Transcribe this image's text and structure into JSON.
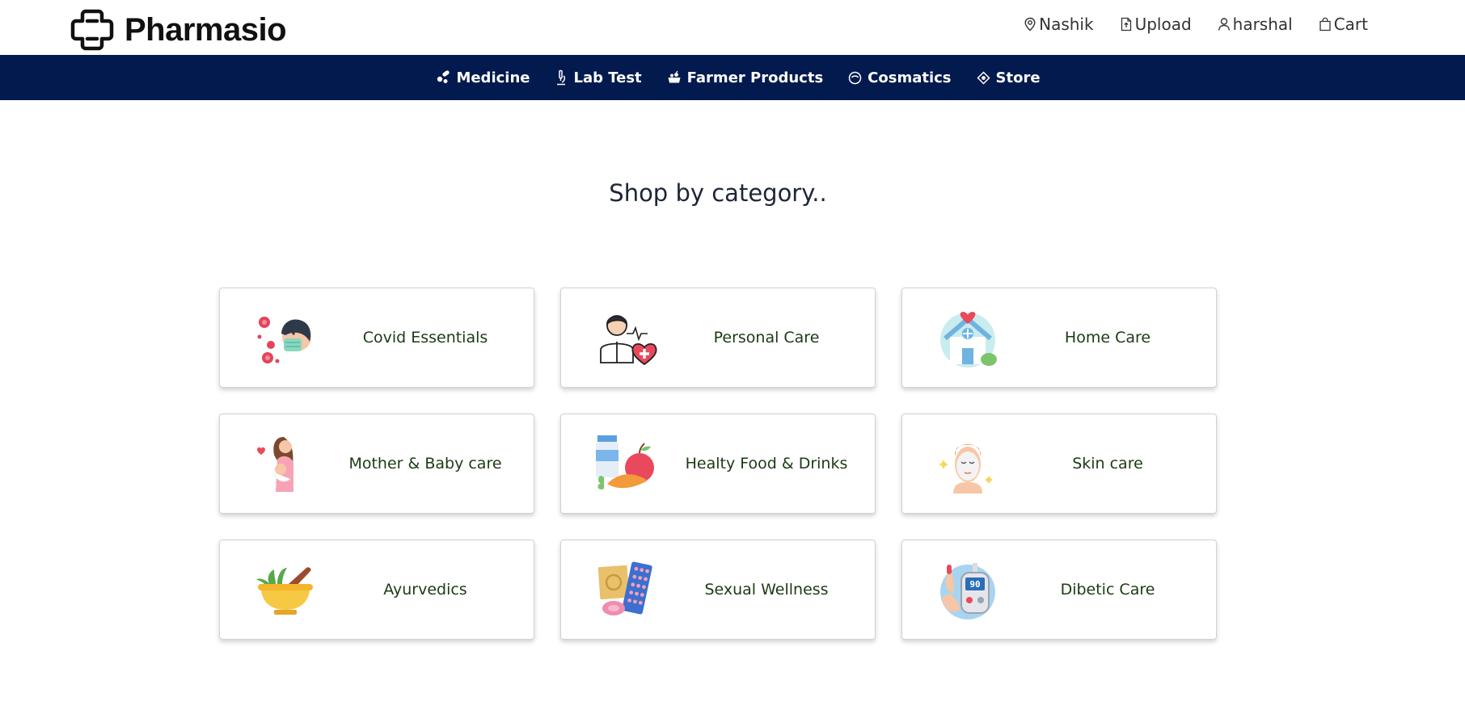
{
  "header": {
    "brand": "Pharmasio",
    "links": [
      {
        "label": "Nashik",
        "icon": "location-pin-icon"
      },
      {
        "label": "Upload",
        "icon": "file-upload-icon"
      },
      {
        "label": "harshal",
        "icon": "user-icon"
      },
      {
        "label": "Cart",
        "icon": "shopping-bag-icon"
      }
    ]
  },
  "nav": {
    "items": [
      {
        "label": "Medicine",
        "icon": "pills-icon"
      },
      {
        "label": "Lab Test",
        "icon": "microscope-icon"
      },
      {
        "label": "Farmer Products",
        "icon": "basket-icon"
      },
      {
        "label": "Cosmatics",
        "icon": "cosmetic-icon"
      },
      {
        "label": "Store",
        "icon": "store-icon"
      }
    ]
  },
  "main": {
    "heading": "Shop by category..",
    "categories": [
      {
        "label": "Covid Essentials",
        "icon": "covid-mask-icon"
      },
      {
        "label": "Personal Care",
        "icon": "doctor-heart-icon"
      },
      {
        "label": "Home Care",
        "icon": "home-care-icon"
      },
      {
        "label": "Mother & Baby care",
        "icon": "mother-baby-icon"
      },
      {
        "label": "Healty Food & Drinks",
        "icon": "healthy-food-icon"
      },
      {
        "label": "Skin care",
        "icon": "face-mask-icon"
      },
      {
        "label": "Ayurvedics",
        "icon": "mortar-pestle-icon"
      },
      {
        "label": "Sexual Wellness",
        "icon": "wellness-pack-icon"
      },
      {
        "label": "Dibetic Care",
        "icon": "glucometer-icon"
      }
    ]
  },
  "colors": {
    "navbar_bg": "#031a4f",
    "category_text": "#1b3a14",
    "heading_text": "#1e2537"
  }
}
